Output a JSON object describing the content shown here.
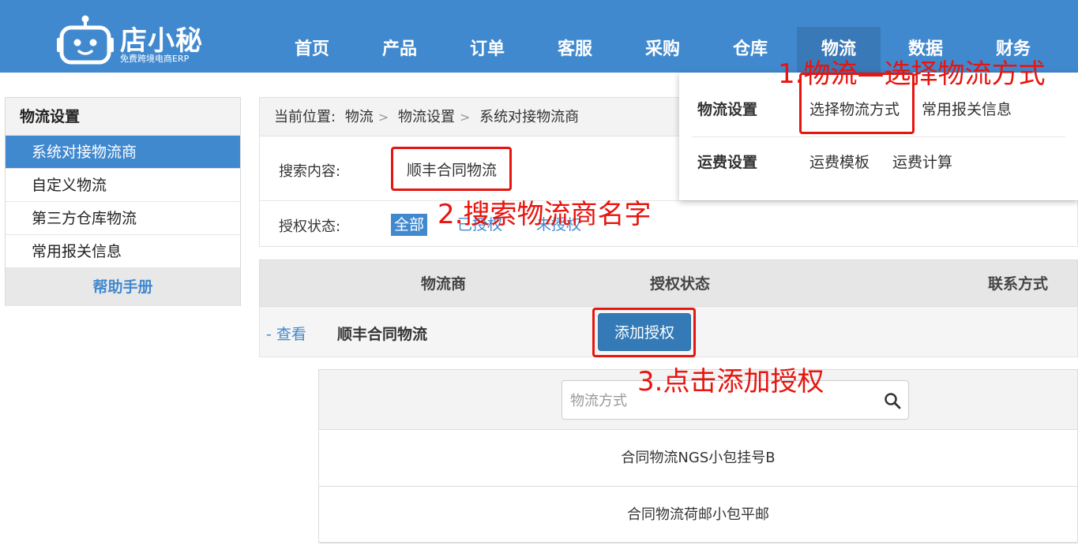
{
  "logo": {
    "title": "店小秘",
    "subtitle": "免费跨境电商ERP",
    "icon": "robot-logo-icon"
  },
  "nav": {
    "items": [
      {
        "label": "首页"
      },
      {
        "label": "产品"
      },
      {
        "label": "订单"
      },
      {
        "label": "客服"
      },
      {
        "label": "采购"
      },
      {
        "label": "仓库"
      },
      {
        "label": "物流"
      },
      {
        "label": "数据"
      },
      {
        "label": "财务"
      }
    ],
    "active": "物流"
  },
  "sidebar": {
    "title": "物流设置",
    "items": [
      {
        "label": "系统对接物流商"
      },
      {
        "label": "自定义物流"
      },
      {
        "label": "第三方仓库物流"
      },
      {
        "label": "常用报关信息"
      }
    ],
    "help": "帮助手册"
  },
  "breadcrumb": {
    "prefix": "当前位置:",
    "items": [
      "物流",
      "物流设置",
      "系统对接物流商"
    ]
  },
  "filter": {
    "search_label": "搜索内容:",
    "search_value": "顺丰合同物流",
    "status_label": "授权状态:",
    "tabs": [
      "全部",
      "已授权",
      "未授权"
    ]
  },
  "table": {
    "headers": [
      "物流商",
      "授权状态",
      "联系方式"
    ],
    "rows": [
      {
        "view": "- 查看",
        "name": "顺丰合同物流",
        "action": "添加授权"
      }
    ]
  },
  "dropdown": {
    "groups": [
      {
        "title": "物流设置",
        "links": [
          "选择物流方式",
          "常用报关信息"
        ]
      },
      {
        "title": "运费设置",
        "links": [
          "运费模板",
          "运费计算"
        ]
      }
    ]
  },
  "popup": {
    "search_placeholder": "物流方式",
    "items": [
      "合同物流NGS小包挂号B",
      "合同物流荷邮小包平邮"
    ]
  },
  "annotations": {
    "step1": "1.物流—选择物流方式",
    "step2": "2.搜索物流商名字",
    "step3": "3.点击添加授权"
  },
  "colors": {
    "header_bg": "#4189cf",
    "accent": "#4189cf",
    "button": "#337ab7",
    "annotation": "#e8140f"
  }
}
